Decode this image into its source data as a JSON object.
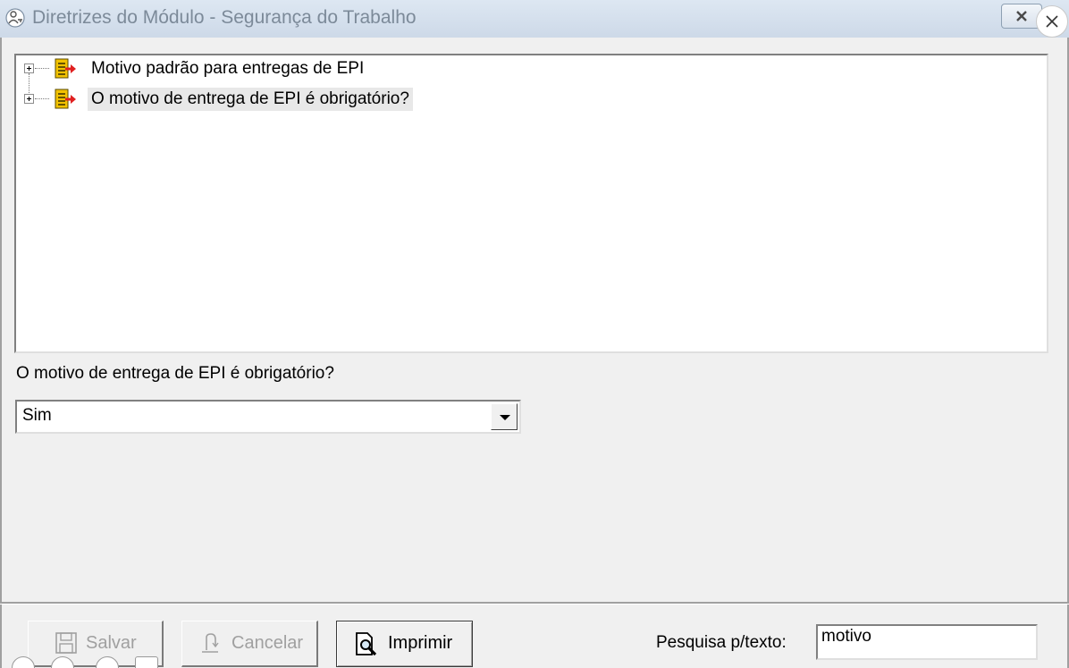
{
  "window": {
    "title": "Diretrizes do Módulo - Segurança do Trabalho",
    "app_icon": "user-key-icon",
    "close_icon": "close-icon"
  },
  "overlay": {
    "close_icon": "close-circle-icon",
    "zoom_icons": [
      "zoom-in-icon",
      "zoom-out-icon",
      "zoom-reset-icon",
      "fit-screen-icon"
    ]
  },
  "tree": {
    "items": [
      {
        "label": "Motivo padrão para entregas de EPI",
        "icon": "document-arrow-icon",
        "expanded": false,
        "selected": false
      },
      {
        "label": "O motivo de entrega de EPI é obrigatório?",
        "icon": "document-arrow-icon",
        "expanded": false,
        "selected": true
      }
    ]
  },
  "detail": {
    "label": "O motivo de entrega de EPI é obrigatório?",
    "select_value": "Sim"
  },
  "buttons": {
    "save": {
      "label": "Salvar",
      "icon": "save-icon",
      "enabled": false
    },
    "cancel": {
      "label": "Cancelar",
      "icon": "undo-icon",
      "enabled": false
    },
    "print": {
      "label": "Imprimir",
      "icon": "print-preview-icon",
      "enabled": true
    }
  },
  "search": {
    "label": "Pesquisa p/texto:",
    "value": "motivo"
  },
  "colors": {
    "titlebar": "#cdd9e8",
    "background": "#f0f0f0",
    "selection": "#e8e8e8",
    "icon_arrow": "#e02020",
    "icon_doc": "#f2c200"
  }
}
